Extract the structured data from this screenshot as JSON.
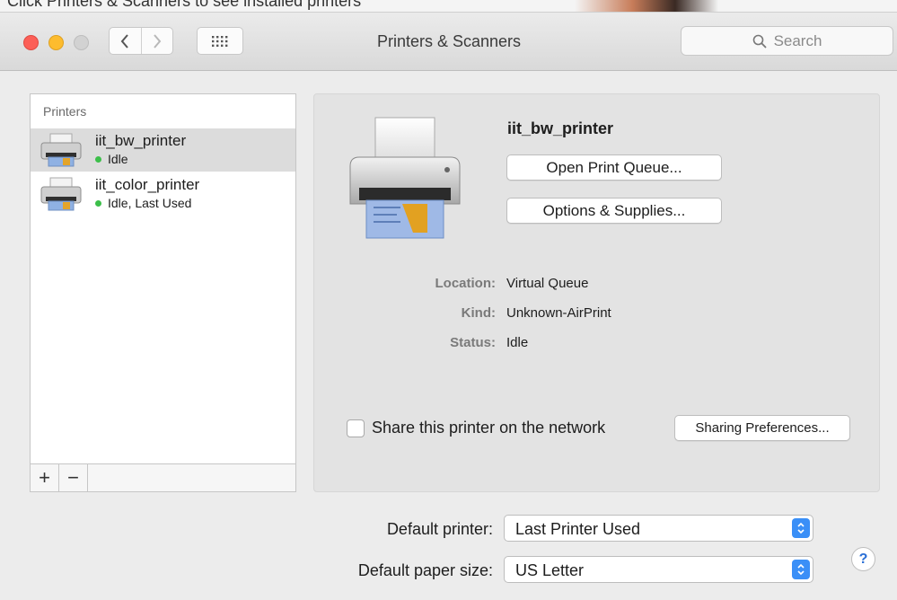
{
  "window": {
    "title": "Printers & Scanners"
  },
  "top_crop_text": "Click Printers & Scanners to see installed printers",
  "search": {
    "placeholder": "Search",
    "icon": "search-icon"
  },
  "sidebar": {
    "header": "Printers",
    "printers": [
      {
        "name": "iit_bw_printer",
        "status": "Idle",
        "selected": true
      },
      {
        "name": "iit_color_printer",
        "status": "Idle, Last Used",
        "selected": false
      }
    ],
    "add_label": "+",
    "remove_label": "−"
  },
  "details": {
    "name": "iit_bw_printer",
    "open_queue_label": "Open Print Queue...",
    "options_label": "Options & Supplies...",
    "info": [
      {
        "label": "Location:",
        "value": "Virtual Queue"
      },
      {
        "label": "Kind:",
        "value": "Unknown-AirPrint"
      },
      {
        "label": "Status:",
        "value": "Idle"
      }
    ],
    "share_label": "Share this printer on the network",
    "share_checked": false,
    "sharing_prefs_label": "Sharing Preferences..."
  },
  "defaults": {
    "printer_label": "Default printer:",
    "printer_value": "Last Printer Used",
    "paper_label": "Default paper size:",
    "paper_value": "US Letter"
  },
  "help_label": "?",
  "colors": {
    "accent": "#3a8ff7",
    "status_green": "#3cbf4a",
    "selected_row": "#dcdcdc"
  }
}
